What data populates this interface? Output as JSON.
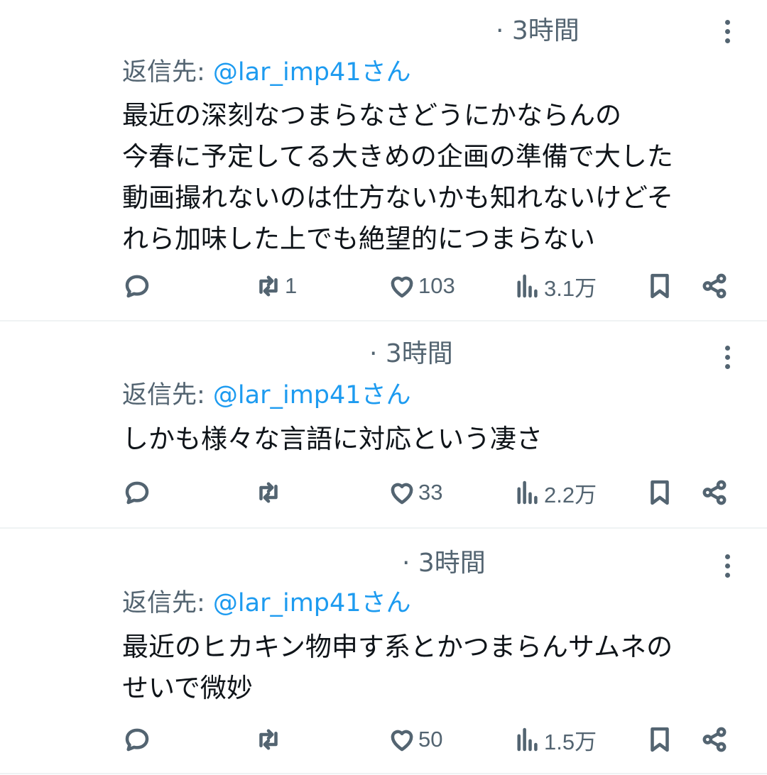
{
  "tweets": [
    {
      "time": "· 3時間",
      "reply_prefix": "返信先: ",
      "reply_handle": "@lar_imp41さん",
      "text": "最近の深刻なつまらなさどうにかならんの\n今春に予定してる大きめの企画の準備で大した\n動画撮れないのは仕方ないかも知れないけどそ\nれら加味した上でも絶望的につまらない",
      "retweets": "1",
      "likes": "103",
      "views": "3.1万"
    },
    {
      "time": "· 3時間",
      "reply_prefix": "返信先: ",
      "reply_handle": "@lar_imp41さん",
      "text": "しかも様々な言語に対応という凄さ",
      "retweets": "",
      "likes": "33",
      "views": "2.2万"
    },
    {
      "time": "· 3時間",
      "reply_prefix": "返信先: ",
      "reply_handle": "@lar_imp41さん",
      "text": "最近のヒカキン物申す系とかつまらんサムネの\nせいで微妙",
      "retweets": "",
      "likes": "50",
      "views": "1.5万"
    }
  ],
  "icons": {
    "reply": "reply-icon",
    "retweet": "retweet-icon",
    "like": "heart-icon",
    "views": "views-icon",
    "bookmark": "bookmark-icon",
    "share": "share-icon",
    "more": "more-vertical-icon"
  },
  "colors": {
    "text": "#0f1419",
    "secondary": "#536471",
    "link": "#1d9bf0",
    "divider": "#eff3f4"
  }
}
